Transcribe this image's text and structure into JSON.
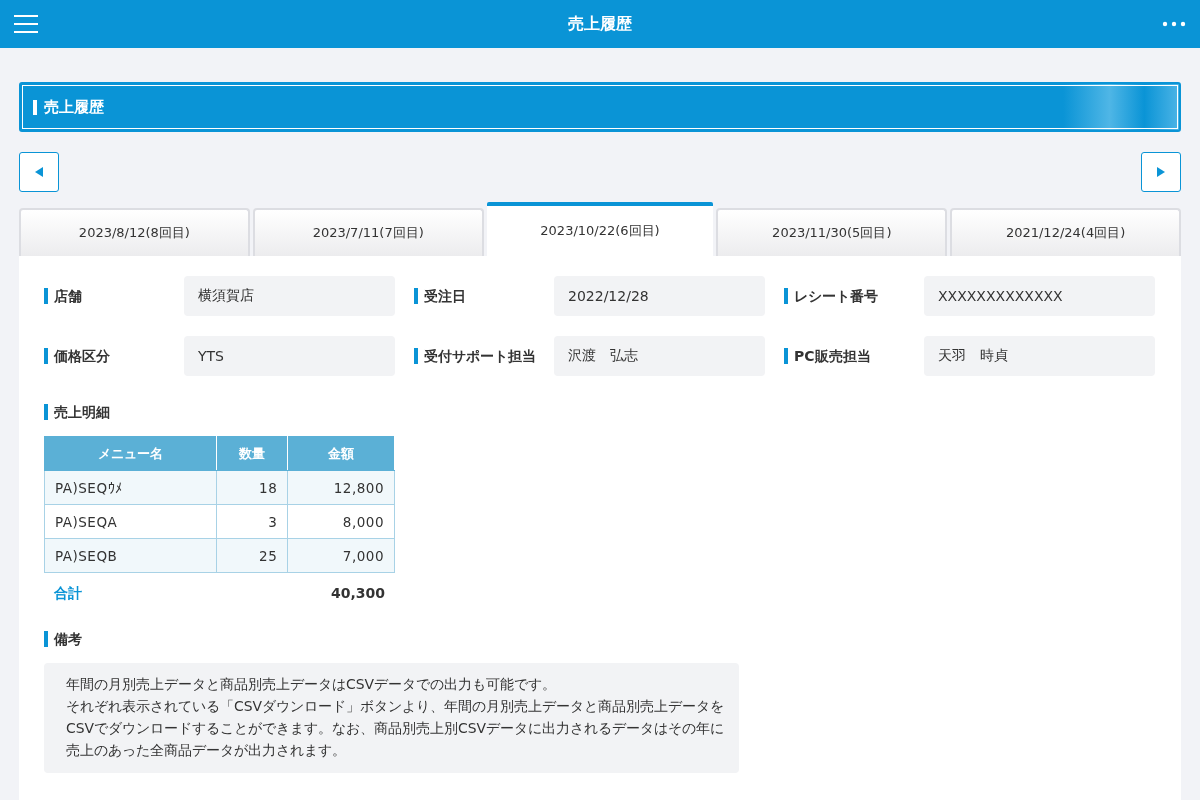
{
  "app_bar": {
    "title": "売上履歴"
  },
  "section_title": "売上履歴",
  "tabs": [
    {
      "label": "2023/8/12(8回目)",
      "selected": false
    },
    {
      "label": "2023/7/11(7回目)",
      "selected": false
    },
    {
      "label": "2023/10/22(6回目)",
      "selected": true
    },
    {
      "label": "2023/11/30(5回目)",
      "selected": false
    },
    {
      "label": "2021/12/24(4回目)",
      "selected": false
    }
  ],
  "fields": [
    {
      "label": "店舗",
      "value": "横須賀店"
    },
    {
      "label": "受注日",
      "value": "2022/12/28"
    },
    {
      "label": "レシート番号",
      "value": "XXXXXXXXXXXXX"
    },
    {
      "label": "価格区分",
      "value": "YTS"
    },
    {
      "label": "受付サポート担当",
      "value": "沢渡　弘志"
    },
    {
      "label": "PC販売担当",
      "value": "天羽　時貞"
    }
  ],
  "details": {
    "heading": "売上明細",
    "columns": [
      "メニュー名",
      "数量",
      "金額"
    ],
    "rows": [
      [
        "PA)SEQｳﾒ",
        "18",
        "12,800"
      ],
      [
        "PA)SEQA",
        "3",
        "8,000"
      ],
      [
        "PA)SEQB",
        "25",
        "7,000"
      ]
    ],
    "total_label": "合計",
    "total": "40,300"
  },
  "notes": {
    "heading": "備考",
    "lines": [
      "年間の月別売上データと商品別売上データはCSVデータでの出力も可能です。",
      "それぞれ表示されている「CSVダウンロード」ボタンより、年間の月別売上データと商品別売上データをCSVでダウンロードすることができます。なお、商品別売上別CSVデータに出力されるデータはその年に売上のあった全商品データが出力されます。"
    ]
  }
}
